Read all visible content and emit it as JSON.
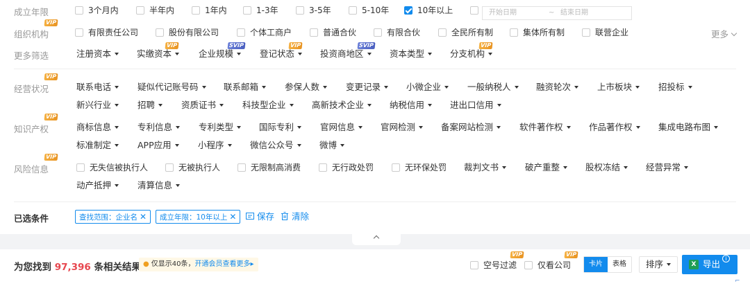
{
  "founded": {
    "label": "成立年限",
    "options": [
      "3个月内",
      "半年内",
      "1年内",
      "1-3年",
      "3-5年",
      "5-10年",
      "10年以上"
    ],
    "checked_index": 6,
    "start_placeholder": "开始日期",
    "range_sep": "~",
    "end_placeholder": "结束日期"
  },
  "org": {
    "label": "组织机构",
    "badge": "VIP",
    "options": [
      "有限责任公司",
      "股份有限公司",
      "个体工商户",
      "普通合伙",
      "有限合伙",
      "全民所有制",
      "集体所有制",
      "联营企业"
    ],
    "more": "更多"
  },
  "more_filters": {
    "label": "更多筛选",
    "items": [
      {
        "label": "注册资本"
      },
      {
        "label": "实缴资本",
        "badge": "VIP"
      },
      {
        "label": "企业规模",
        "badge": "SVIP"
      },
      {
        "label": "登记状态",
        "badge": "VIP"
      },
      {
        "label": "投资商地区",
        "badge": "SVIP"
      },
      {
        "label": "资本类型"
      },
      {
        "label": "分支机构",
        "badge": "VIP"
      }
    ]
  },
  "business": {
    "label": "经营状况",
    "badge": "VIP",
    "line1": [
      "联系电话",
      "疑似代记账号码",
      "联系邮箱",
      "参保人数",
      "变更记录",
      "小微企业",
      "一般纳税人",
      "融资轮次",
      "上市板块",
      "招投标"
    ],
    "line2": [
      "新兴行业",
      "招聘",
      "资质证书",
      "科技型企业",
      "高新技术企业",
      "纳税信用",
      "进出口信用"
    ]
  },
  "ip": {
    "label": "知识产权",
    "badge": "VIP",
    "line1": [
      "商标信息",
      "专利信息",
      "专利类型",
      "国际专利",
      "官网信息",
      "官网检测",
      "备案网站检测",
      "软件著作权",
      "作品著作权",
      "集成电路布图"
    ],
    "line2": [
      "标准制定",
      "APP应用",
      "小程序",
      "微信公众号",
      "微博"
    ]
  },
  "risk": {
    "label": "风险信息",
    "badge": "VIP",
    "checks": [
      "无失信被执行人",
      "无被执行人",
      "无限制高消费",
      "无行政处罚",
      "无环保处罚"
    ],
    "drops1": [
      "裁判文书",
      "破产重整",
      "股权冻结",
      "经营异常"
    ],
    "drops2": [
      "动产抵押",
      "清算信息"
    ]
  },
  "selected": {
    "label": "已选条件",
    "tags": [
      "查找范围：企业名",
      "成立年限：10年以上"
    ],
    "tag_close": "✕",
    "save": "保存",
    "clear": "清除"
  },
  "results": {
    "prefix": "为您找到",
    "count": "97,396",
    "suffix": "条相关结果",
    "notice_text": "仅显示40条，",
    "notice_link": "开通会员查看更多",
    "notice_arrow": "▸",
    "filter_empty_phone": "空号过滤",
    "filter_company_only": "仅看公司",
    "vip_badge": "VIP",
    "view_card": "卡片",
    "view_table": "表格",
    "sort": "排序",
    "export": "导出",
    "export_icon_text": "X",
    "info_icon": "i"
  },
  "colors": {
    "accent": "#128bed",
    "count": "#e7474f",
    "vip": "#f5a623",
    "svip": "#4a5fc0"
  }
}
